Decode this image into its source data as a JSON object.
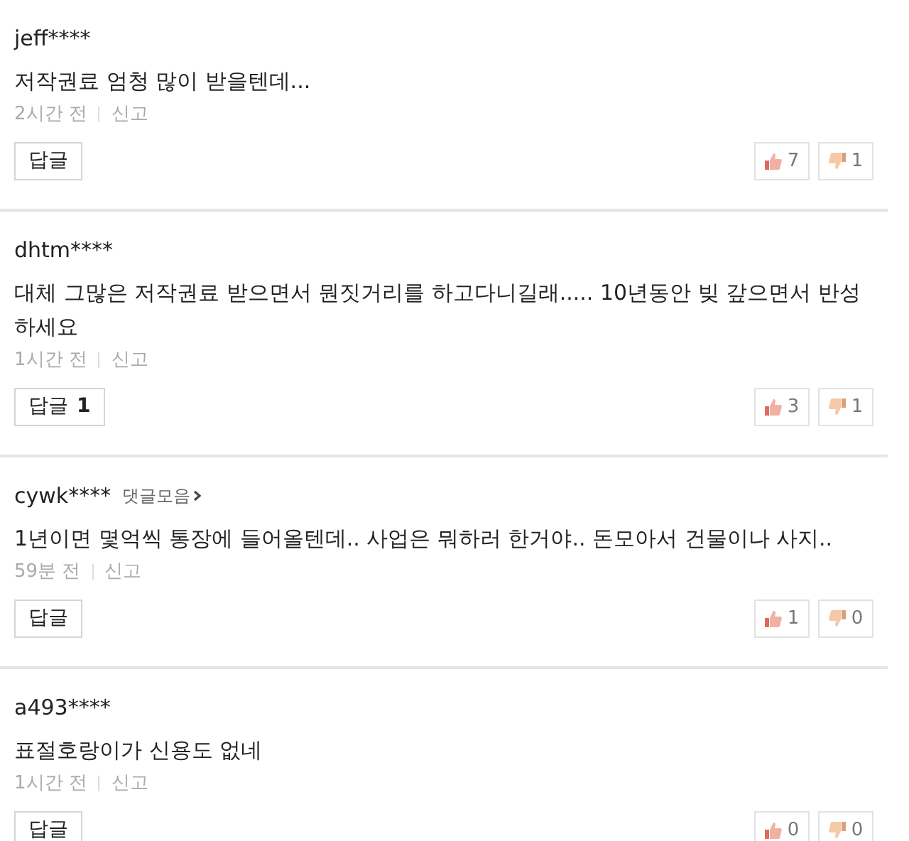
{
  "comments": [
    {
      "author": "jeff****",
      "text": "저작권료 엄청 많이 받을텐데...",
      "time": "2시간 전",
      "report": "신고",
      "reply": "답글",
      "likes": "7",
      "dislikes": "1"
    },
    {
      "author": "dhtm****",
      "text": "대체 그많은 저작권료 받으면서 뭔짓거리를 하고다니길래..... 10년동안 빚 갚으면서 반성 하세요",
      "time": "1시간 전",
      "report": "신고",
      "reply": "답글",
      "reply_count": "1",
      "likes": "3",
      "dislikes": "1"
    },
    {
      "author": "cywk****",
      "collection_link": "댓글모음",
      "text": "1년이면 몇억씩 통장에 들어올텐데.. 사업은 뭐하러 한거야.. 돈모아서 건물이나 사지..",
      "time": "59분 전",
      "report": "신고",
      "reply": "답글",
      "likes": "1",
      "dislikes": "0"
    },
    {
      "author": "a493****",
      "text": "표절호랑이가 신용도 없네",
      "time": "1시간 전",
      "report": "신고",
      "reply": "답글",
      "likes": "0",
      "dislikes": "0"
    }
  ]
}
